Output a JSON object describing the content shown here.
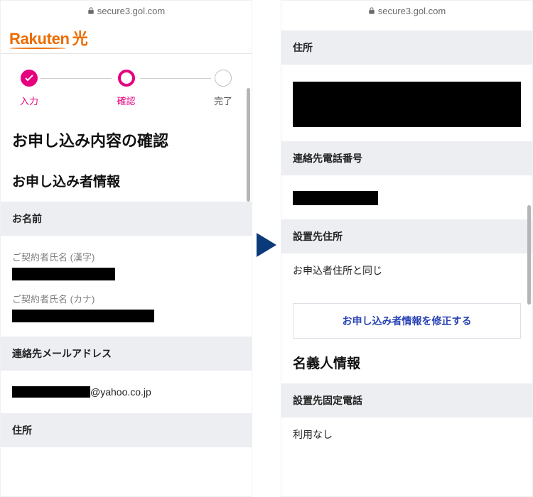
{
  "url": "secure3.gol.com",
  "logo": {
    "brand": "Rakuten",
    "suffix": "光"
  },
  "steps": {
    "input": "入力",
    "confirm": "確認",
    "complete": "完了"
  },
  "left": {
    "pageTitle": "お申し込み内容の確認",
    "applicantSection": "お申し込み者情報",
    "nameHeader": "お名前",
    "kanjiLabel": "ご契約者氏名 (漢字)",
    "kanaLabel": "ご契約者氏名 (カナ)",
    "emailHeader": "連絡先メールアドレス",
    "emailDomain": "@yahoo.co.jp",
    "addressHeader": "住所"
  },
  "right": {
    "addressHeader": "住所",
    "phoneHeader": "連絡先電話番号",
    "installHeader": "設置先住所",
    "installValue": "お申込者住所と同じ",
    "editButton": "お申し込み者情報を修正する",
    "holderSection": "名義人情報",
    "landlineHeader": "設置先固定電話",
    "landlineValue": "利用なし"
  }
}
